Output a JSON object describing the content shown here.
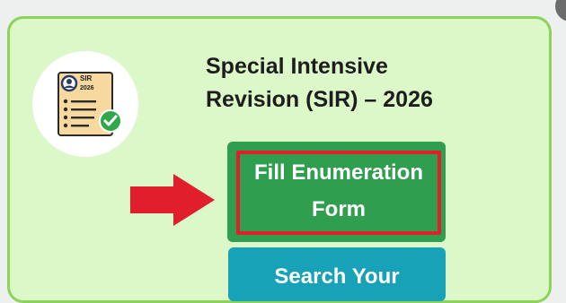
{
  "card": {
    "icon": "sir-form-checklist-icon",
    "icon_badge_line1": "SIR",
    "icon_badge_line2": "2026",
    "title_line1": "Special Intensive",
    "title_line2": "Revision (SIR) – 2026"
  },
  "buttons": {
    "fill_line1": "Fill Enumeration",
    "fill_line2": "Form",
    "search_label": "Search Your"
  },
  "annotation": {
    "arrow_icon": "red-arrow-right-icon",
    "highlight_color": "#e11e2b"
  },
  "colors": {
    "card_background": "#dcf7c8",
    "card_border": "#8bd35b",
    "fill_button": "#2f9e4e",
    "search_button": "#17a2b8"
  }
}
